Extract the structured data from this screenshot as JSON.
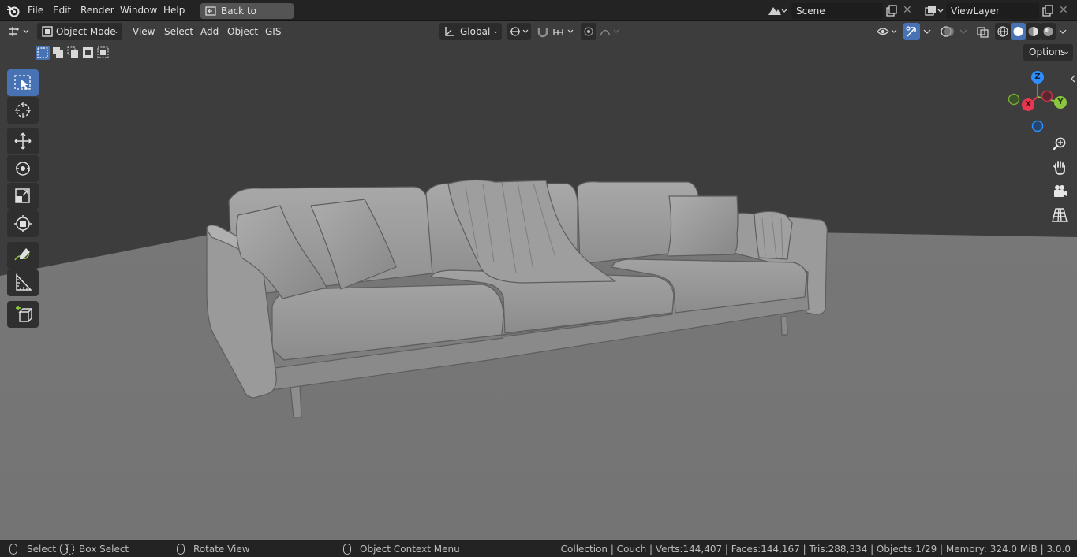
{
  "menubar": {
    "items": [
      "File",
      "Edit",
      "Render",
      "Window",
      "Help"
    ],
    "back_to_previous": "Back to Previous",
    "scene_name": "Scene",
    "view_layer_name": "ViewLayer"
  },
  "viewport_header": {
    "mode": "Object Mode",
    "menus": [
      "View",
      "Select",
      "Add",
      "Object",
      "GIS"
    ],
    "transform_orientation": "Global",
    "options_label": "Options"
  },
  "gizmo": {
    "axes": {
      "z": "Z",
      "x": "X",
      "y": "Y"
    },
    "colors": {
      "x": "#e8364f",
      "y": "#8cc63f",
      "z": "#2c8fff"
    }
  },
  "toolbar": {
    "tools": [
      "select-box-tool",
      "cursor-tool",
      "move-tool",
      "rotate-tool",
      "scale-tool",
      "transform-tool",
      "annotate-tool",
      "measure-tool",
      "add-cube-tool"
    ],
    "active": "select-box-tool"
  },
  "statusbar": {
    "select": "Select",
    "box_select": "Box Select",
    "rotate_view": "Rotate View",
    "context_menu": "Object Context Menu",
    "stats": "Collection | Couch | Verts:144,407 | Faces:144,167 | Tris:288,334 | Objects:1/29 | Memory: 324.0 MiB | 3.0.0"
  },
  "colors": {
    "accent": "#4772b3",
    "viewport_bg": "#3d3d3d",
    "floor": "#7a7a7a"
  }
}
